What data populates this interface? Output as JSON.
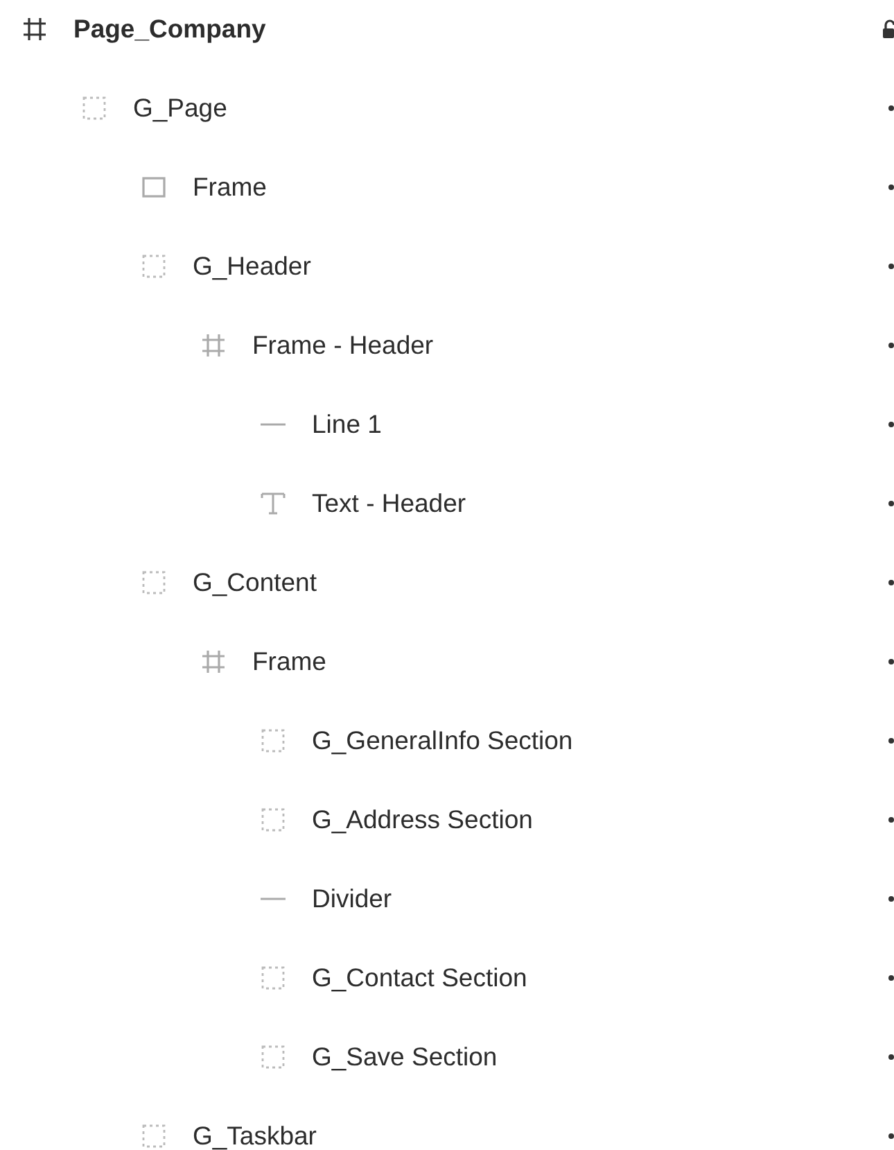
{
  "layers": [
    {
      "kind": "frame",
      "label": "Page_Company",
      "locked": true,
      "children": [
        {
          "kind": "group",
          "label": "G_Page",
          "locked": false,
          "children": [
            {
              "kind": "rectangle",
              "label": "Frame",
              "locked": false
            },
            {
              "kind": "group",
              "label": "G_Header",
              "locked": false,
              "children": [
                {
                  "kind": "frame",
                  "label": "Frame - Header",
                  "locked": false,
                  "children": [
                    {
                      "kind": "line",
                      "label": "Line 1",
                      "locked": false
                    },
                    {
                      "kind": "text",
                      "label": "Text - Header",
                      "locked": false
                    }
                  ]
                }
              ]
            },
            {
              "kind": "group",
              "label": "G_Content",
              "locked": false,
              "children": [
                {
                  "kind": "frame",
                  "label": "Frame",
                  "locked": false,
                  "children": [
                    {
                      "kind": "group",
                      "label": "G_GeneralInfo Section",
                      "locked": false
                    },
                    {
                      "kind": "group",
                      "label": "G_Address Section",
                      "locked": false
                    },
                    {
                      "kind": "line",
                      "label": "Divider",
                      "locked": false
                    },
                    {
                      "kind": "group",
                      "label": "G_Contact Section",
                      "locked": false
                    },
                    {
                      "kind": "group",
                      "label": "G_Save Section",
                      "locked": false
                    }
                  ]
                }
              ]
            },
            {
              "kind": "group",
              "label": "G_Taskbar",
              "locked": false
            }
          ]
        }
      ]
    }
  ]
}
